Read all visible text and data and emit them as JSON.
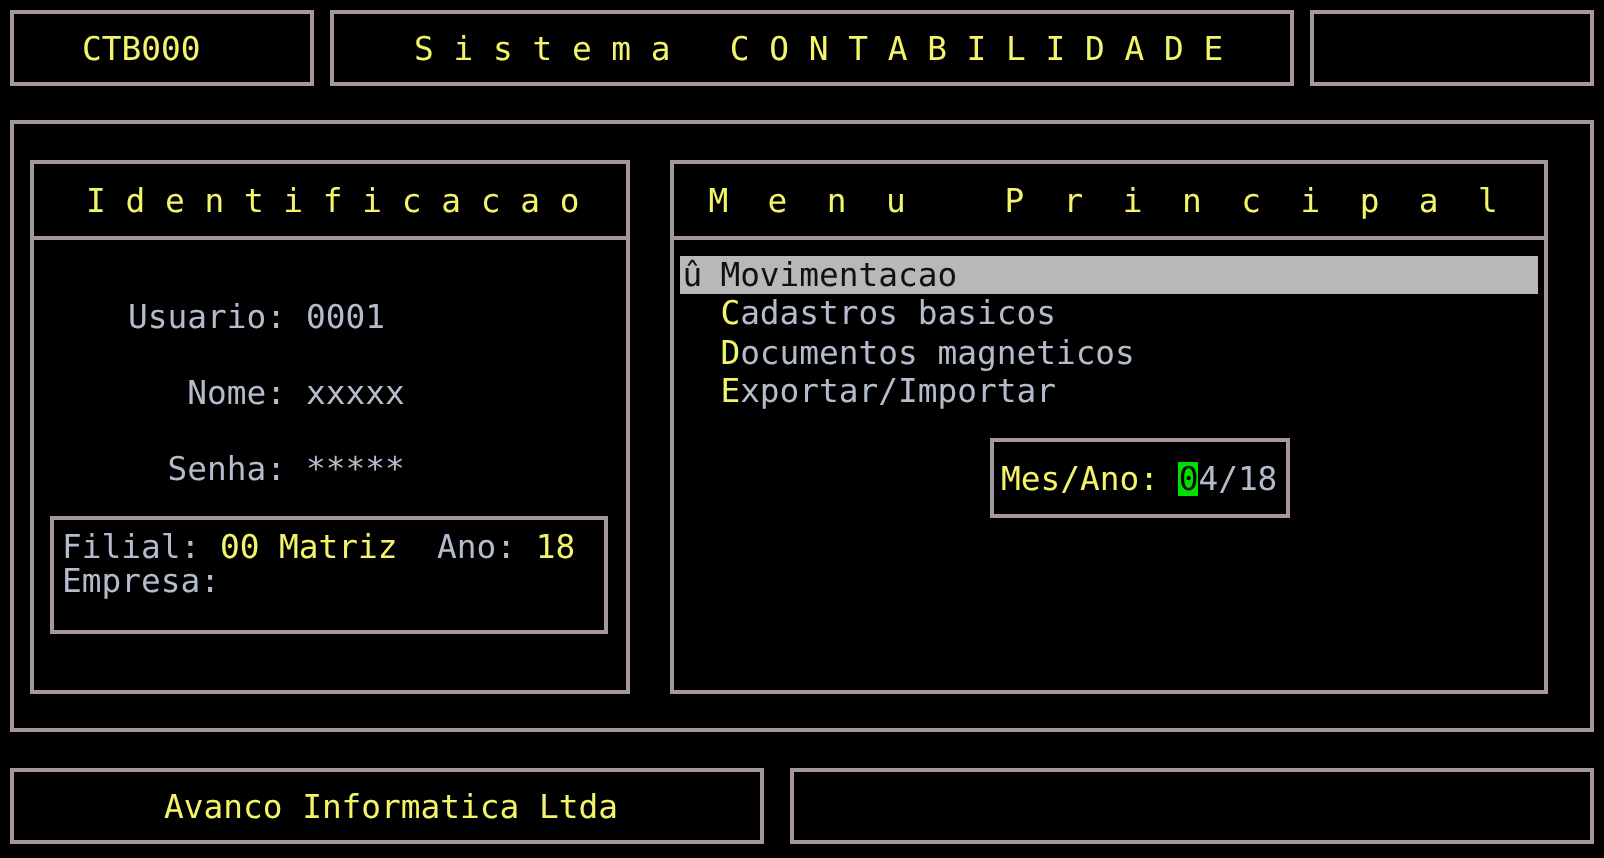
{
  "header": {
    "code": "CTB000",
    "title": "S i s t e m a   C O N T A B I L I D A D E"
  },
  "identificacao": {
    "title": "I d e n t i f i c a c a o",
    "fields": [
      {
        "label": "Usuario:",
        "value": "0001"
      },
      {
        "label": "Nome:",
        "value": "xxxxx"
      },
      {
        "label": "Senha:",
        "value": "*****"
      }
    ],
    "filial": {
      "label": "Filial:",
      "value": "00 Matriz"
    },
    "ano": {
      "label": "Ano:",
      "value": "18"
    },
    "empresa": {
      "label": "Empresa:"
    }
  },
  "menu": {
    "title": "M  e  n  u     P  r  i  n  c  i  p  a  l",
    "cursor": "û",
    "items": [
      {
        "label": "Movimentacao",
        "selected": true
      },
      {
        "label": "Cadastros basicos",
        "selected": false
      },
      {
        "label": "Documentos magneticos",
        "selected": false
      },
      {
        "label": "Exportar/Importar",
        "selected": false
      }
    ]
  },
  "period": {
    "label": "Mes/Ano:",
    "value": "04/18",
    "focused": true
  },
  "footer": {
    "company": "Avanco Informatica Ltda"
  }
}
